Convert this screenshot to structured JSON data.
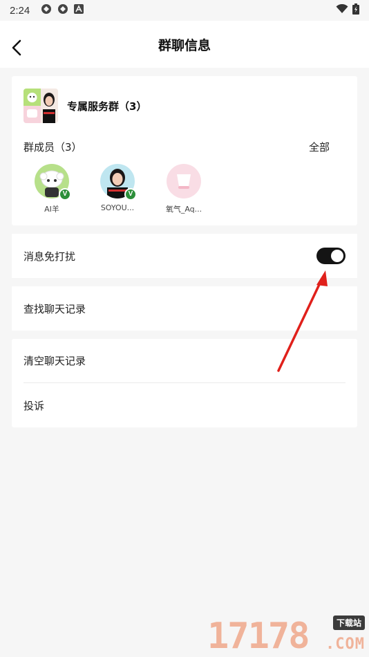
{
  "status_bar": {
    "time": "2:24",
    "icons": [
      "app-notification-icon",
      "app-notification-icon",
      "a-notification-icon",
      "wifi-icon",
      "battery-icon"
    ]
  },
  "header": {
    "title": "群聊信息",
    "back_icon": "chevron-left-icon"
  },
  "group": {
    "name": "专属服务群（3）",
    "members_label": "群成员（3）",
    "view_all_label": "全部",
    "members": [
      {
        "name": "AI羊",
        "verified": true,
        "badge": "V"
      },
      {
        "name": "SOYOU...",
        "verified": true,
        "badge": "V"
      },
      {
        "name": "氧气_Aq...",
        "verified": false,
        "badge": ""
      }
    ]
  },
  "settings": {
    "do_not_disturb": {
      "label": "消息免打扰",
      "enabled": true
    },
    "search_history": {
      "label": "查找聊天记录"
    },
    "clear_history": {
      "label": "清空聊天记录"
    },
    "report": {
      "label": "投诉"
    }
  },
  "watermark": {
    "digits": "17178",
    "tag": "下载站",
    "suffix": ".COM"
  },
  "colors": {
    "background": "#f6f6f6",
    "card": "#ffffff",
    "toggle_on": "#141414",
    "verified_badge": "#2c8f3a",
    "annotation_arrow": "#e0201b"
  }
}
